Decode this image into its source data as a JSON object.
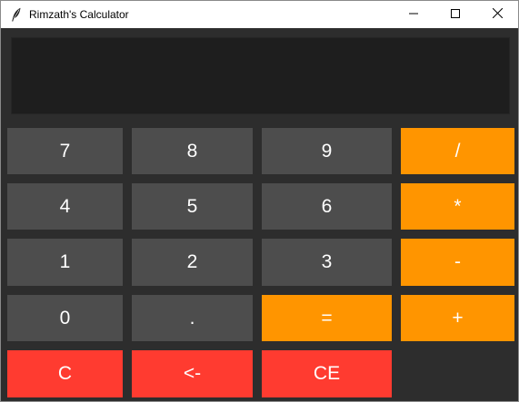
{
  "window": {
    "title": "Rimzath's Calculator",
    "controls": [
      "minimize",
      "maximize",
      "close"
    ]
  },
  "display": {
    "value": ""
  },
  "colors": {
    "background": "#2d2d2d",
    "display_bg": "#1e1e1e",
    "number_key": "#4d4d4d",
    "operator_key": "#ff9500",
    "clear_key": "#ff3b30",
    "key_text": "#ffffff"
  },
  "keys": {
    "seven": "7",
    "eight": "8",
    "nine": "9",
    "divide": "/",
    "four": "4",
    "five": "5",
    "six": "6",
    "multiply": "*",
    "one": "1",
    "two": "2",
    "three": "3",
    "subtract": "-",
    "zero": "0",
    "decimal": ".",
    "equals": "=",
    "add": "+",
    "clear": "C",
    "backspace": "<-",
    "clear_entry": "CE"
  }
}
